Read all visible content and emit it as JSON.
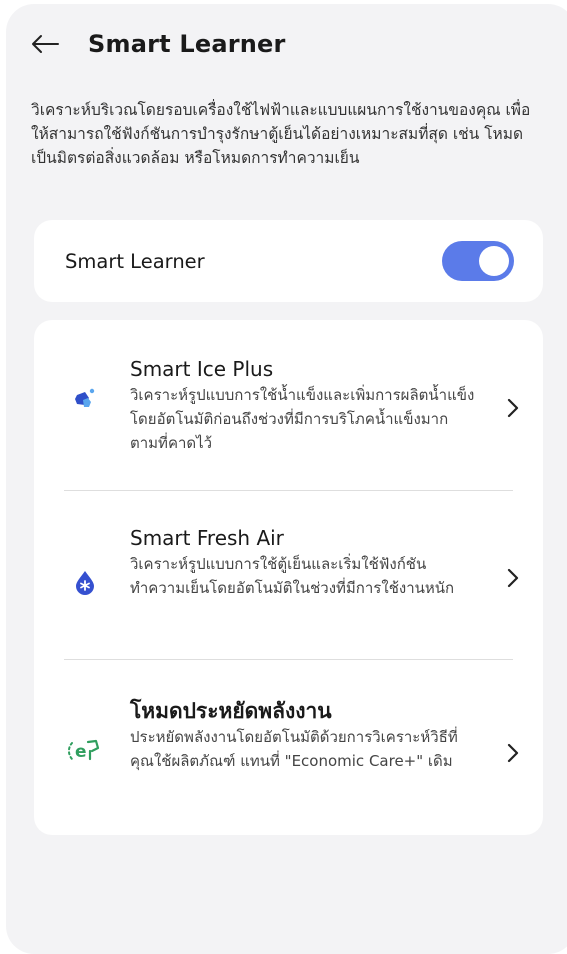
{
  "header": {
    "title": "Smart Learner",
    "back_icon": "arrow-left-icon"
  },
  "description": "วิเคราะห์บริเวณโดยรอบเครื่องใช้ไฟฟ้าและแบบแผนการใช้งานของคุณ เพื่อให้สามารถใช้ฟังก์ชันการบำรุงรักษาตู้เย็นได้อย่างเหมาะสมที่สุด เช่น โหมดเป็นมิตรต่อสิ่งแวดล้อม หรือโหมดการทำความเย็น",
  "toggle": {
    "label": "Smart Learner",
    "state": "on",
    "accent_color": "#5b7be9"
  },
  "features": [
    {
      "title": "Smart Ice Plus",
      "description": "วิเคราะห์รูปแบบการใช้น้ำแข็งและเพิ่มการผลิตน้ำแข็งโดยอัตโนมัติก่อนถึงช่วงที่มีการบริโภคน้ำแข็งมากตามที่คาดไว้",
      "icon": "ice-cubes-icon",
      "icon_color": "#3d6fe0"
    },
    {
      "title": "Smart Fresh Air",
      "description": "วิเคราะห์รูปแบบการใช้ตู้เย็นและเริ่มใช้ฟังก์ชันทำความเย็นโดยอัตโนมัติในช่วงที่มีการใช้งานหนัก",
      "icon": "fresh-air-drop-icon",
      "icon_color": "#3d5bd6"
    },
    {
      "title": "โหมดประหยัดพลังงาน",
      "description": "ประหยัดพลังงานโดยอัตโนมัติด้วยการวิเคราะห์วิธีที่คุณใช้ผลิตภัณฑ์ แทนที่ \"Economic Care+\" เดิม",
      "icon": "eco-energy-icon",
      "icon_color": "#2f9e5e"
    }
  ]
}
